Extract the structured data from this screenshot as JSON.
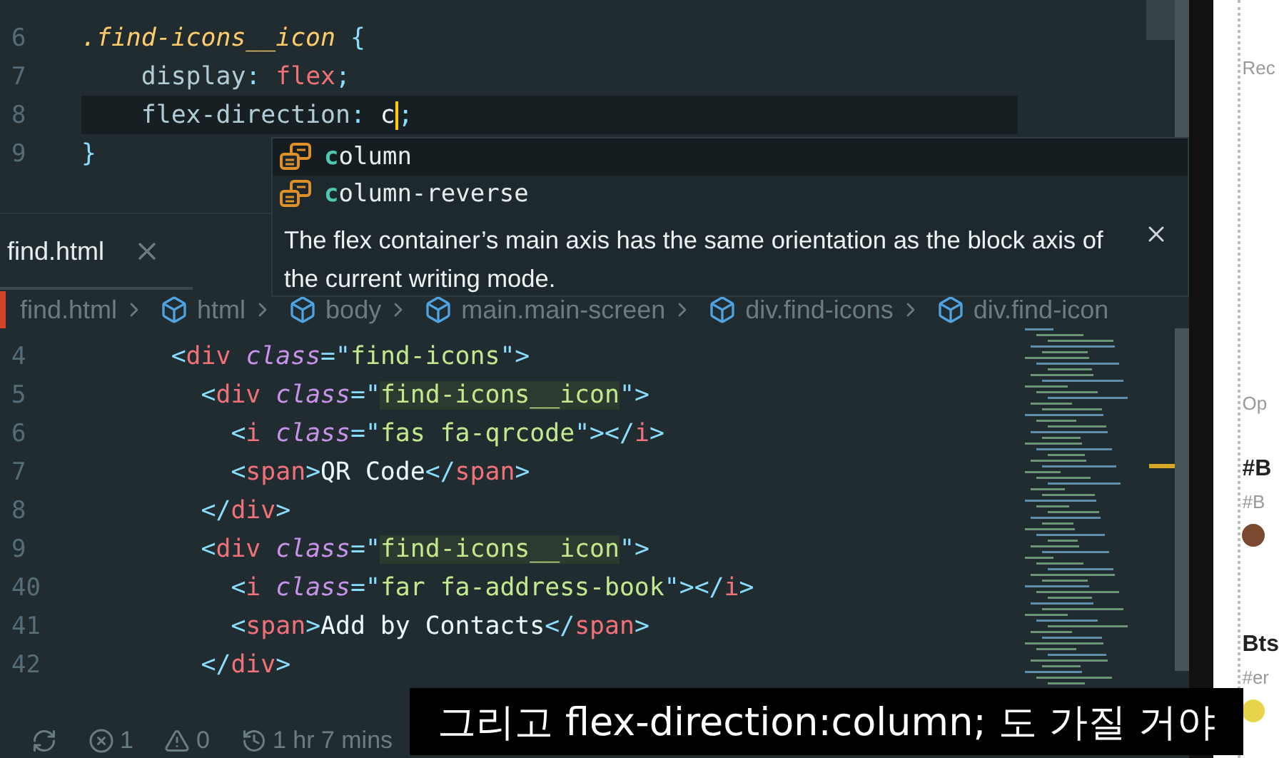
{
  "top_editor": {
    "lines": [
      {
        "number": "6",
        "current": false,
        "tokens": [
          {
            "kind": "selector",
            "text": ".find-icons__icon"
          },
          {
            "kind": "bracket",
            "text": " {"
          }
        ]
      },
      {
        "number": "7",
        "current": false,
        "tokens": [
          {
            "kind": "prop",
            "text": "    display"
          },
          {
            "kind": "punct",
            "text": ":"
          },
          {
            "kind": "value",
            "text": " flex"
          },
          {
            "kind": "punct",
            "text": ";"
          }
        ]
      },
      {
        "number": "8",
        "current": true,
        "tokens": [
          {
            "kind": "prop",
            "text": "    flex-direction"
          },
          {
            "kind": "punct",
            "text": ":"
          },
          {
            "kind": "plain",
            "text": " c"
          },
          {
            "kind": "cursor"
          },
          {
            "kind": "punct",
            "text": ";"
          }
        ]
      },
      {
        "number": "9",
        "current": false,
        "tokens": [
          {
            "kind": "bracket",
            "text": "}"
          }
        ]
      }
    ]
  },
  "suggest": {
    "items": [
      {
        "label": "**c**olumn",
        "selected": true
      },
      {
        "label": "**c**olumn-reverse",
        "selected": false
      }
    ],
    "description": "The flex container’s main axis has the same orientation as the block axis of the current writing mode."
  },
  "tab": {
    "label": "find.html"
  },
  "breadcrumb": [
    {
      "label": "find.html",
      "kind": "file"
    },
    {
      "label": "html",
      "kind": "element"
    },
    {
      "label": "body",
      "kind": "element"
    },
    {
      "label": "main.main-screen",
      "kind": "element"
    },
    {
      "label": "div.find-icons",
      "kind": "element"
    },
    {
      "label": "div.find-icon",
      "kind": "element"
    }
  ],
  "bottom_editor": {
    "lines": [
      {
        "number": "4",
        "tokens": [
          {
            "kind": "punct",
            "text": "      <"
          },
          {
            "kind": "tag",
            "text": "div"
          },
          {
            "kind": "attr",
            "text": " class"
          },
          {
            "kind": "punct",
            "text": "=\""
          },
          {
            "kind": "string",
            "text": "find-icons"
          },
          {
            "kind": "punct",
            "text": "\">"
          }
        ]
      },
      {
        "number": "5",
        "tokens": [
          {
            "kind": "punct",
            "text": "        <"
          },
          {
            "kind": "tag",
            "text": "div"
          },
          {
            "kind": "attr",
            "text": " class"
          },
          {
            "kind": "punct",
            "text": "=\""
          },
          {
            "kind": "string-hl",
            "text": "find-icons__icon"
          },
          {
            "kind": "punct",
            "text": "\">"
          }
        ]
      },
      {
        "number": "6",
        "tokens": [
          {
            "kind": "punct",
            "text": "          <"
          },
          {
            "kind": "tag",
            "text": "i"
          },
          {
            "kind": "attr",
            "text": " class"
          },
          {
            "kind": "punct",
            "text": "=\""
          },
          {
            "kind": "string",
            "text": "fas fa-qrcode"
          },
          {
            "kind": "punct",
            "text": "\"></"
          },
          {
            "kind": "tag",
            "text": "i"
          },
          {
            "kind": "punct",
            "text": ">"
          }
        ]
      },
      {
        "number": "7",
        "tokens": [
          {
            "kind": "punct",
            "text": "          <"
          },
          {
            "kind": "tag",
            "text": "span"
          },
          {
            "kind": "punct",
            "text": ">"
          },
          {
            "kind": "plain",
            "text": "QR Code"
          },
          {
            "kind": "punct",
            "text": "</"
          },
          {
            "kind": "tag",
            "text": "span"
          },
          {
            "kind": "punct",
            "text": ">"
          }
        ]
      },
      {
        "number": "8",
        "tokens": [
          {
            "kind": "punct",
            "text": "        </"
          },
          {
            "kind": "tag",
            "text": "div"
          },
          {
            "kind": "punct",
            "text": ">"
          }
        ]
      },
      {
        "number": "9",
        "tokens": [
          {
            "kind": "punct",
            "text": "        <"
          },
          {
            "kind": "tag",
            "text": "div"
          },
          {
            "kind": "attr",
            "text": " class"
          },
          {
            "kind": "punct",
            "text": "=\""
          },
          {
            "kind": "string-hl",
            "text": "find-icons__icon"
          },
          {
            "kind": "punct",
            "text": "\">"
          }
        ]
      },
      {
        "number": "40",
        "tokens": [
          {
            "kind": "punct",
            "text": "          <"
          },
          {
            "kind": "tag",
            "text": "i"
          },
          {
            "kind": "attr",
            "text": " class"
          },
          {
            "kind": "punct",
            "text": "=\""
          },
          {
            "kind": "string",
            "text": "far fa-address-book"
          },
          {
            "kind": "punct",
            "text": "\"></"
          },
          {
            "kind": "tag",
            "text": "i"
          },
          {
            "kind": "punct",
            "text": ">"
          }
        ]
      },
      {
        "number": "41",
        "tokens": [
          {
            "kind": "punct",
            "text": "          <"
          },
          {
            "kind": "tag",
            "text": "span"
          },
          {
            "kind": "punct",
            "text": ">"
          },
          {
            "kind": "plain",
            "text": "Add by Contacts"
          },
          {
            "kind": "punct",
            "text": "</"
          },
          {
            "kind": "tag",
            "text": "span"
          },
          {
            "kind": "punct",
            "text": ">"
          }
        ]
      },
      {
        "number": "42",
        "tokens": [
          {
            "kind": "punct",
            "text": "        </"
          },
          {
            "kind": "tag",
            "text": "div"
          },
          {
            "kind": "punct",
            "text": ">"
          }
        ]
      }
    ]
  },
  "status_bar": [
    {
      "kind": "sync"
    },
    {
      "kind": "error",
      "text": "1"
    },
    {
      "kind": "warning",
      "text": "0"
    },
    {
      "kind": "history",
      "text": "1 hr 7 mins"
    }
  ],
  "side_panel": [
    {
      "kind": "muted",
      "text": "Rec"
    },
    {
      "kind": "muted",
      "text": "Op"
    },
    {
      "kind": "title",
      "text": "#B"
    },
    {
      "kind": "muted",
      "text": "#B"
    },
    {
      "kind": "avatar"
    },
    {
      "kind": "title",
      "text": "Bts"
    },
    {
      "kind": "muted",
      "text": "#er"
    },
    {
      "kind": "emoji"
    }
  ],
  "subtitle": "그리고 flex-direction:column; 도 가질 거야"
}
